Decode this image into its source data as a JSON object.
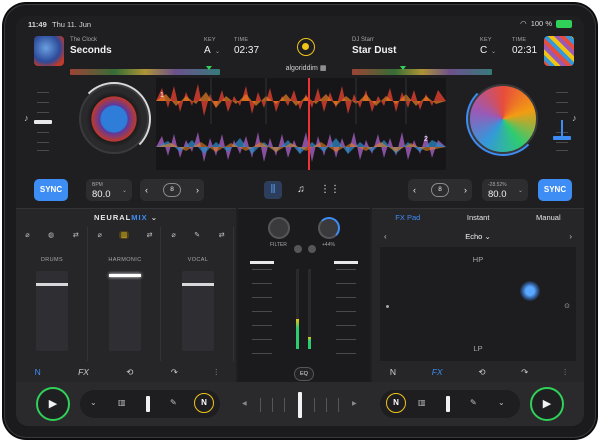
{
  "status": {
    "time": "11:49",
    "date": "Thu 11. Jun",
    "battery_pct": "100 %",
    "battery_label": ""
  },
  "deck_a": {
    "artist": "The Clock",
    "title": "Seconds",
    "key_label": "KEY",
    "key": "A",
    "time_label": "TIME",
    "time": "02:37",
    "bpm_label": "BPM",
    "bpm": "80.0",
    "sync": "SYNC",
    "loop": "8",
    "cue": "1"
  },
  "deck_b": {
    "artist": "DJ Starr",
    "title": "Star Dust",
    "key_label": "KEY",
    "key": "C",
    "time_label": "TIME",
    "time": "02:31",
    "bpm_label": "-28.52%",
    "bpm": "80.0",
    "sync": "SYNC",
    "loop": "8",
    "cue": "2"
  },
  "brand": "algoriddim",
  "neural_mix": {
    "title_a": "NEURAL",
    "title_b": "MIX",
    "stems": [
      {
        "name": "DRUMS",
        "level": 0.8
      },
      {
        "name": "HARMONIC",
        "level": 0.95
      },
      {
        "name": "VOCAL",
        "level": 0.8
      }
    ]
  },
  "mixer": {
    "filter_label": "FILTER",
    "fx_amount": "+44%",
    "eq": "EQ"
  },
  "fx": {
    "tabs": [
      "FX Pad",
      "Instant",
      "Manual"
    ],
    "selected_tab": "FX Pad",
    "effect": "Echo",
    "hp": "HP",
    "lp": "LP"
  },
  "icons": {
    "neural": "N",
    "fx": "FX",
    "play": "▶"
  },
  "colors": {
    "accent": "#3d8df5",
    "record": "#f0c419",
    "play_ring": "#30d158"
  }
}
